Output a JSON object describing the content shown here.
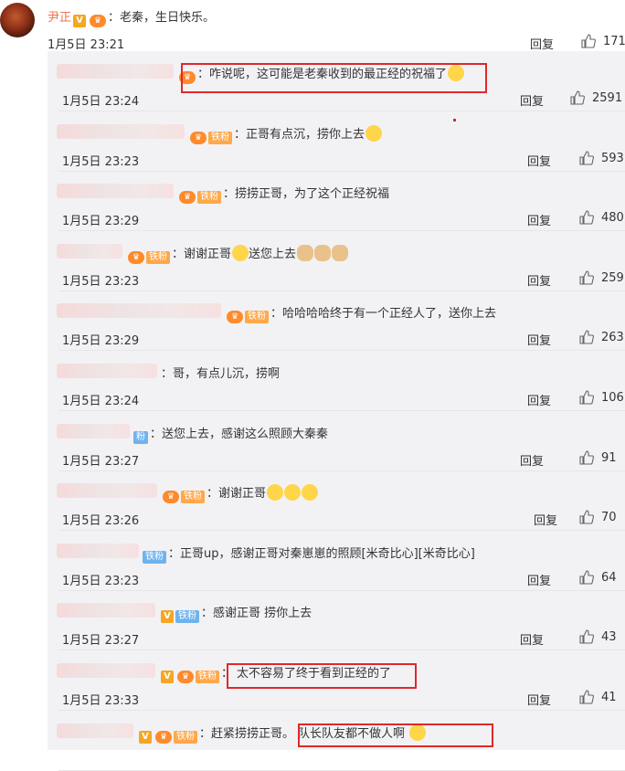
{
  "top": {
    "username": "尹正",
    "text": "：老秦，生日快乐。",
    "time": "1月5日 23:21",
    "reply": "回复",
    "likes": "171"
  },
  "replies": [
    {
      "badge": "lvl",
      "text": "：咋说呢，这可能是老秦收到的最正经的祝福了",
      "time": "1月5日 23:24",
      "reply": "回复",
      "likes": "2591",
      "highlight": true
    },
    {
      "badge": "lvl-fan",
      "fan": "铁粉",
      "text": "：正哥有点沉，捞你上去",
      "time": "1月5日 23:23",
      "reply": "回复",
      "likes": "593"
    },
    {
      "badge": "lvl-fan",
      "fan": "铁粉",
      "text": "：捞捞正哥，为了这个正经祝福",
      "time": "1月5日 23:29",
      "reply": "回复",
      "likes": "480"
    },
    {
      "badge": "lvl-fan",
      "fan": "铁粉",
      "text": "：谢谢正哥",
      "tail": "送您上去",
      "time": "1月5日 23:23",
      "reply": "回复",
      "likes": "259"
    },
    {
      "badge": "lvl-fan",
      "fan": "铁粉",
      "text": "：哈哈哈哈终于有一个正经人了，送你上去",
      "time": "1月5日 23:29",
      "reply": "回复",
      "likes": "263"
    },
    {
      "badge": "none",
      "text": "：哥，有点儿沉，捞啊",
      "time": "1月5日 23:24",
      "reply": "回复",
      "likes": "106"
    },
    {
      "badge": "fan-blue",
      "fan": "粉",
      "text": "：送您上去，感谢这么照顾大秦秦",
      "time": "1月5日 23:27",
      "reply": "回复",
      "likes": "91"
    },
    {
      "badge": "lvl-fan",
      "fan": "铁粉",
      "text": "：谢谢正哥",
      "time": "1月5日 23:26",
      "reply": "回复",
      "likes": "70"
    },
    {
      "badge": "fan-blue",
      "fan": "铁粉",
      "text": "：正哥up，感谢正哥对秦崽崽的照顾[米奇比心][米奇比心]",
      "time": "1月5日 23:23",
      "reply": "回复",
      "likes": "64"
    },
    {
      "badge": "v-fan-blue",
      "fan": "铁粉",
      "text": "：感谢正哥 捞你上去",
      "time": "1月5日 23:27",
      "reply": "回复",
      "likes": "43"
    },
    {
      "badge": "v-lvl-fan",
      "fan": "铁粉",
      "text": "：",
      "hltext": "太不容易了终于看到正经的了",
      "time": "1月5日 23:33",
      "reply": "回复",
      "likes": "41"
    },
    {
      "badge": "v-lvl-fan",
      "fan": "铁粉",
      "text": "：赶紧捞捞正哥。",
      "hltext": "队长队友都不做人啊",
      "time": "",
      "reply": "",
      "likes": ""
    }
  ]
}
